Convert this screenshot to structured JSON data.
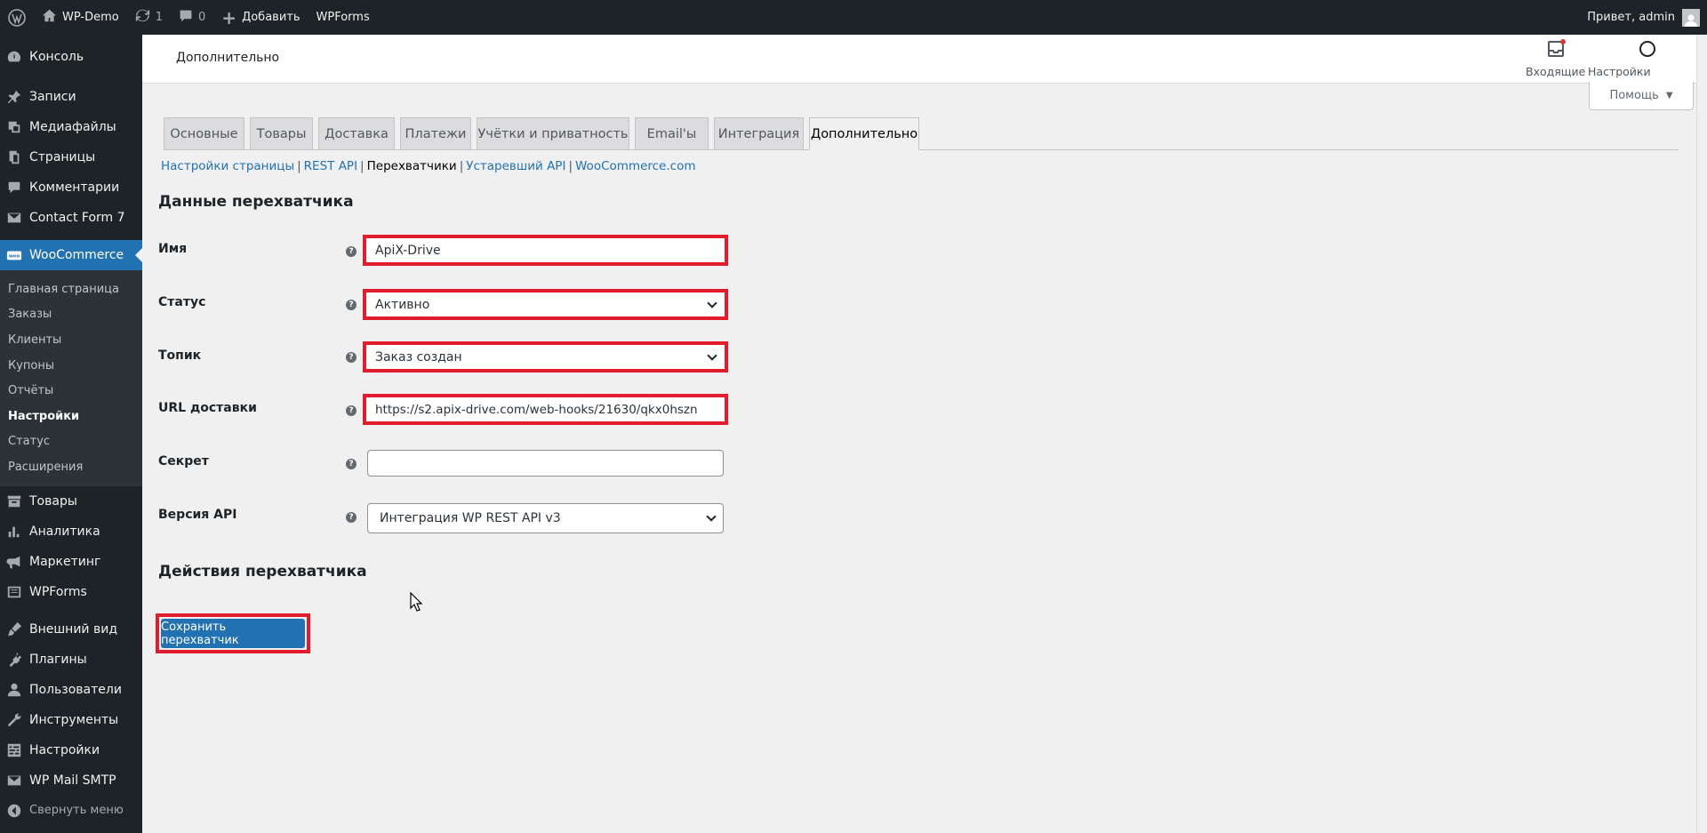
{
  "adminbar": {
    "site_name": "WP-Demo",
    "updates_count": "1",
    "comments_count": "0",
    "add_new_label": "Добавить",
    "wpforms_label": "WPForms",
    "greeting": "Привет, admin"
  },
  "sidebar": {
    "items": [
      {
        "label": "Консоль",
        "icon": "dashboard-icon"
      },
      {
        "label": "Записи",
        "icon": "pin-icon"
      },
      {
        "label": "Медиафайлы",
        "icon": "media-icon"
      },
      {
        "label": "Страницы",
        "icon": "pages-icon"
      },
      {
        "label": "Комментарии",
        "icon": "comment-icon"
      },
      {
        "label": "Contact Form 7",
        "icon": "mail-icon"
      },
      {
        "label": "WooCommerce",
        "icon": "woo-icon"
      }
    ],
    "woo_submenu": [
      "Главная страница",
      "Заказы",
      "Клиенты",
      "Купоны",
      "Отчёты",
      "Настройки",
      "Статус",
      "Расширения"
    ],
    "items_after": [
      {
        "label": "Товары",
        "icon": "archive-icon"
      },
      {
        "label": "Аналитика",
        "icon": "bar-chart-icon"
      },
      {
        "label": "Маркетинг",
        "icon": "megaphone-icon"
      },
      {
        "label": "WPForms",
        "icon": "form-icon"
      },
      {
        "label": "Внешний вид",
        "icon": "brush-icon"
      },
      {
        "label": "Плагины",
        "icon": "plugin-icon"
      },
      {
        "label": "Пользователи",
        "icon": "users-icon"
      },
      {
        "label": "Инструменты",
        "icon": "wrench-icon"
      },
      {
        "label": "Настройки",
        "icon": "settings-icon"
      },
      {
        "label": "WP Mail SMTP",
        "icon": "envelope-icon"
      }
    ],
    "collapse_label": "Свернуть меню"
  },
  "header": {
    "page_name": "Дополнительно",
    "inbox_label": "Входящие",
    "store_settings_label": "Настройки магазина",
    "help_label": "Помощь"
  },
  "tabs": [
    "Основные",
    "Товары",
    "Доставка",
    "Платежи",
    "Учётки и приватность",
    "Email'ы",
    "Интеграция",
    "Дополнительно"
  ],
  "subnav": {
    "items": [
      "Настройки страницы",
      "REST API",
      "Перехватчики",
      "Устаревший API",
      "WooCommerce.com"
    ],
    "current": "Перехватчики"
  },
  "form": {
    "section_title": "Данные перехватчика",
    "name_label": "Имя",
    "name_value": "ApiX-Drive",
    "status_label": "Статус",
    "status_value": "Активно",
    "topic_label": "Топик",
    "topic_value": "Заказ создан",
    "url_label": "URL доставки",
    "url_value": "https://s2.apix-drive.com/web-hooks/21630/qkx0hszn",
    "secret_label": "Секрет",
    "secret_value": "",
    "api_label": "Версия API",
    "api_value": "Интеграция WP REST API v3",
    "help_glyph": "?",
    "actions_title": "Действия перехватчика",
    "save_label": "Сохранить перехватчик"
  },
  "colors": {
    "highlight": "#e11d2d",
    "accent": "#2271b1",
    "sidebar_bg": "#1d2327"
  }
}
